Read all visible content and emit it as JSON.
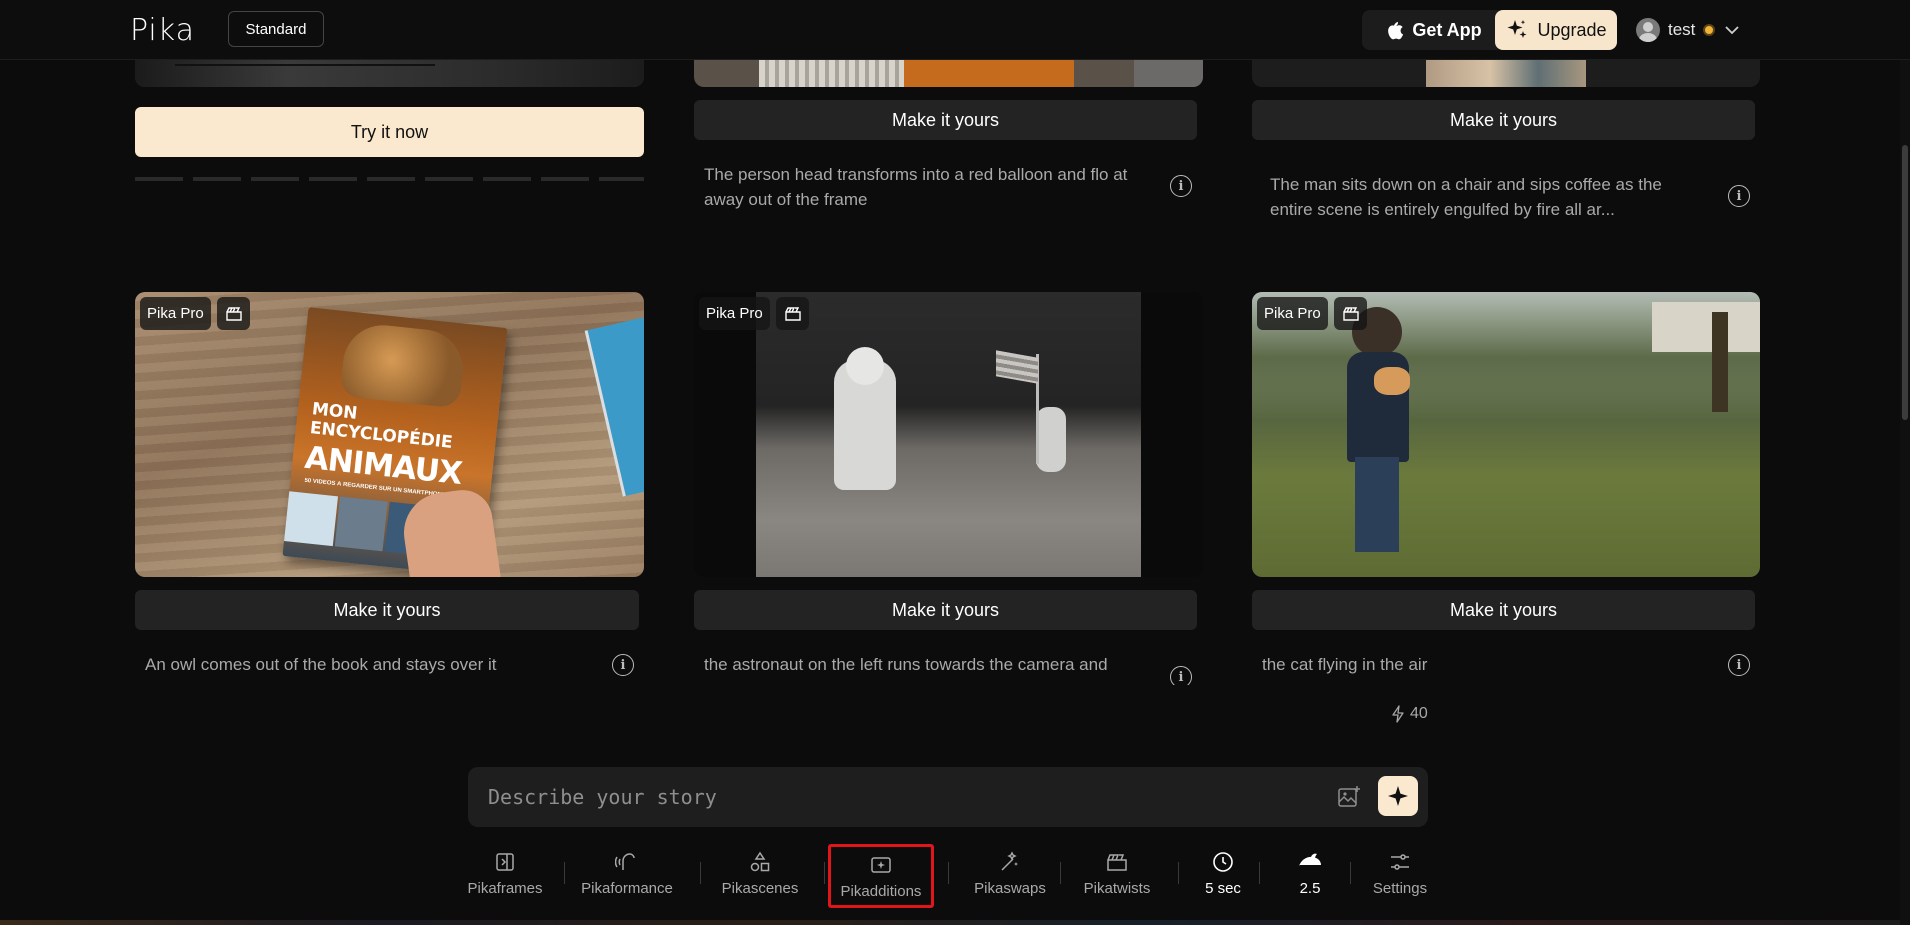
{
  "app": {
    "name": "Pika",
    "plan": "Standard"
  },
  "header": {
    "get_app_label": "Get App",
    "upgrade_label": "Upgrade",
    "username": "test"
  },
  "feed": {
    "try_now_label": "Try it now",
    "make_label": "Make it yours",
    "pro_tag": "Pika Pro",
    "row1": [
      {
        "caption": ""
      },
      {
        "caption": "The person head transforms into a red balloon and flo at away out of the frame"
      },
      {
        "caption": "The man sits down on a chair and sips coffee as the entire scene is entirely engulfed by fire all ar..."
      }
    ],
    "row2": [
      {
        "caption": "An owl comes out of the book and stays over it",
        "book_title": "MON ENCYCLOPÉDIE",
        "book_subtitle": "ANIMAUX",
        "book_tagline": "50 VIDÉOS À REGARDER SUR UN SMARTPHONE"
      },
      {
        "caption": "the astronaut on the left runs towards the camera and"
      },
      {
        "caption": "the cat flying in the air"
      }
    ]
  },
  "credits": {
    "count": "40"
  },
  "prompt": {
    "placeholder": "Describe your story"
  },
  "toolbar": {
    "items": [
      {
        "label": "Pikaframes",
        "icon": "frames-icon"
      },
      {
        "label": "Pikaformance",
        "icon": "performance-icon"
      },
      {
        "label": "Pikascenes",
        "icon": "shapes-icon"
      },
      {
        "label": "Pikadditions",
        "icon": "add-image-icon"
      },
      {
        "label": "Pikaswaps",
        "icon": "magic-wand-icon"
      },
      {
        "label": "Pikatwists",
        "icon": "clapper-icon"
      },
      {
        "label": "5 sec",
        "icon": "clock-icon"
      },
      {
        "label": "2.5",
        "icon": "model-icon"
      },
      {
        "label": "Settings",
        "icon": "sliders-icon"
      }
    ]
  },
  "colors": {
    "accent": "#fbe9cf",
    "background": "#0c0c0c",
    "highlight": "#e0161b"
  }
}
